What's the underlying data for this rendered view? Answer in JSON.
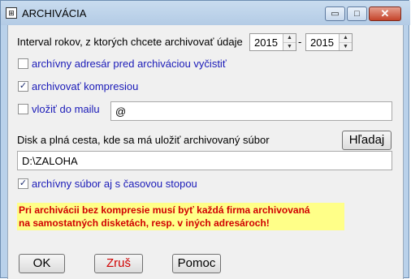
{
  "window": {
    "title": "ARCHIVÁCIA",
    "icon_glyph": "⊞",
    "minimize_glyph": "▭",
    "maximize_glyph": "□",
    "close_glyph": "✕"
  },
  "interval": {
    "label": "Interval rokov, z ktorých chcete archivovať údaje",
    "from_year": "2015",
    "separator": "-",
    "to_year": "2015"
  },
  "options": {
    "clear_dir_label": "archívny adresár pred archiváciou vyčistiť",
    "clear_dir_checked": false,
    "compress_label": "archivovať kompresiou",
    "compress_checked": true,
    "email_label": "vložiť do mailu",
    "email_checked": false,
    "email_value": "@",
    "timestamp_label": "archívny súbor aj s časovou stopou",
    "timestamp_checked": true
  },
  "path": {
    "label": "Disk a plná cesta, kde sa má uložiť archivovaný súbor",
    "search_button": "Hľadaj",
    "value": "D:\\ZALOHA"
  },
  "warning": {
    "line1": "Pri archivácii bez kompresie musí byť každá firma archivovaná",
    "line2": "na samostatných disketách, resp. v iných adresároch!"
  },
  "buttons": {
    "ok": "OK",
    "cancel": "Zruš",
    "help": "Pomoc"
  },
  "colors": {
    "option_text": "#1a1ab8",
    "warning_text": "#d00000",
    "warning_bg": "#ffff88",
    "cancel_text": "#d00000"
  }
}
